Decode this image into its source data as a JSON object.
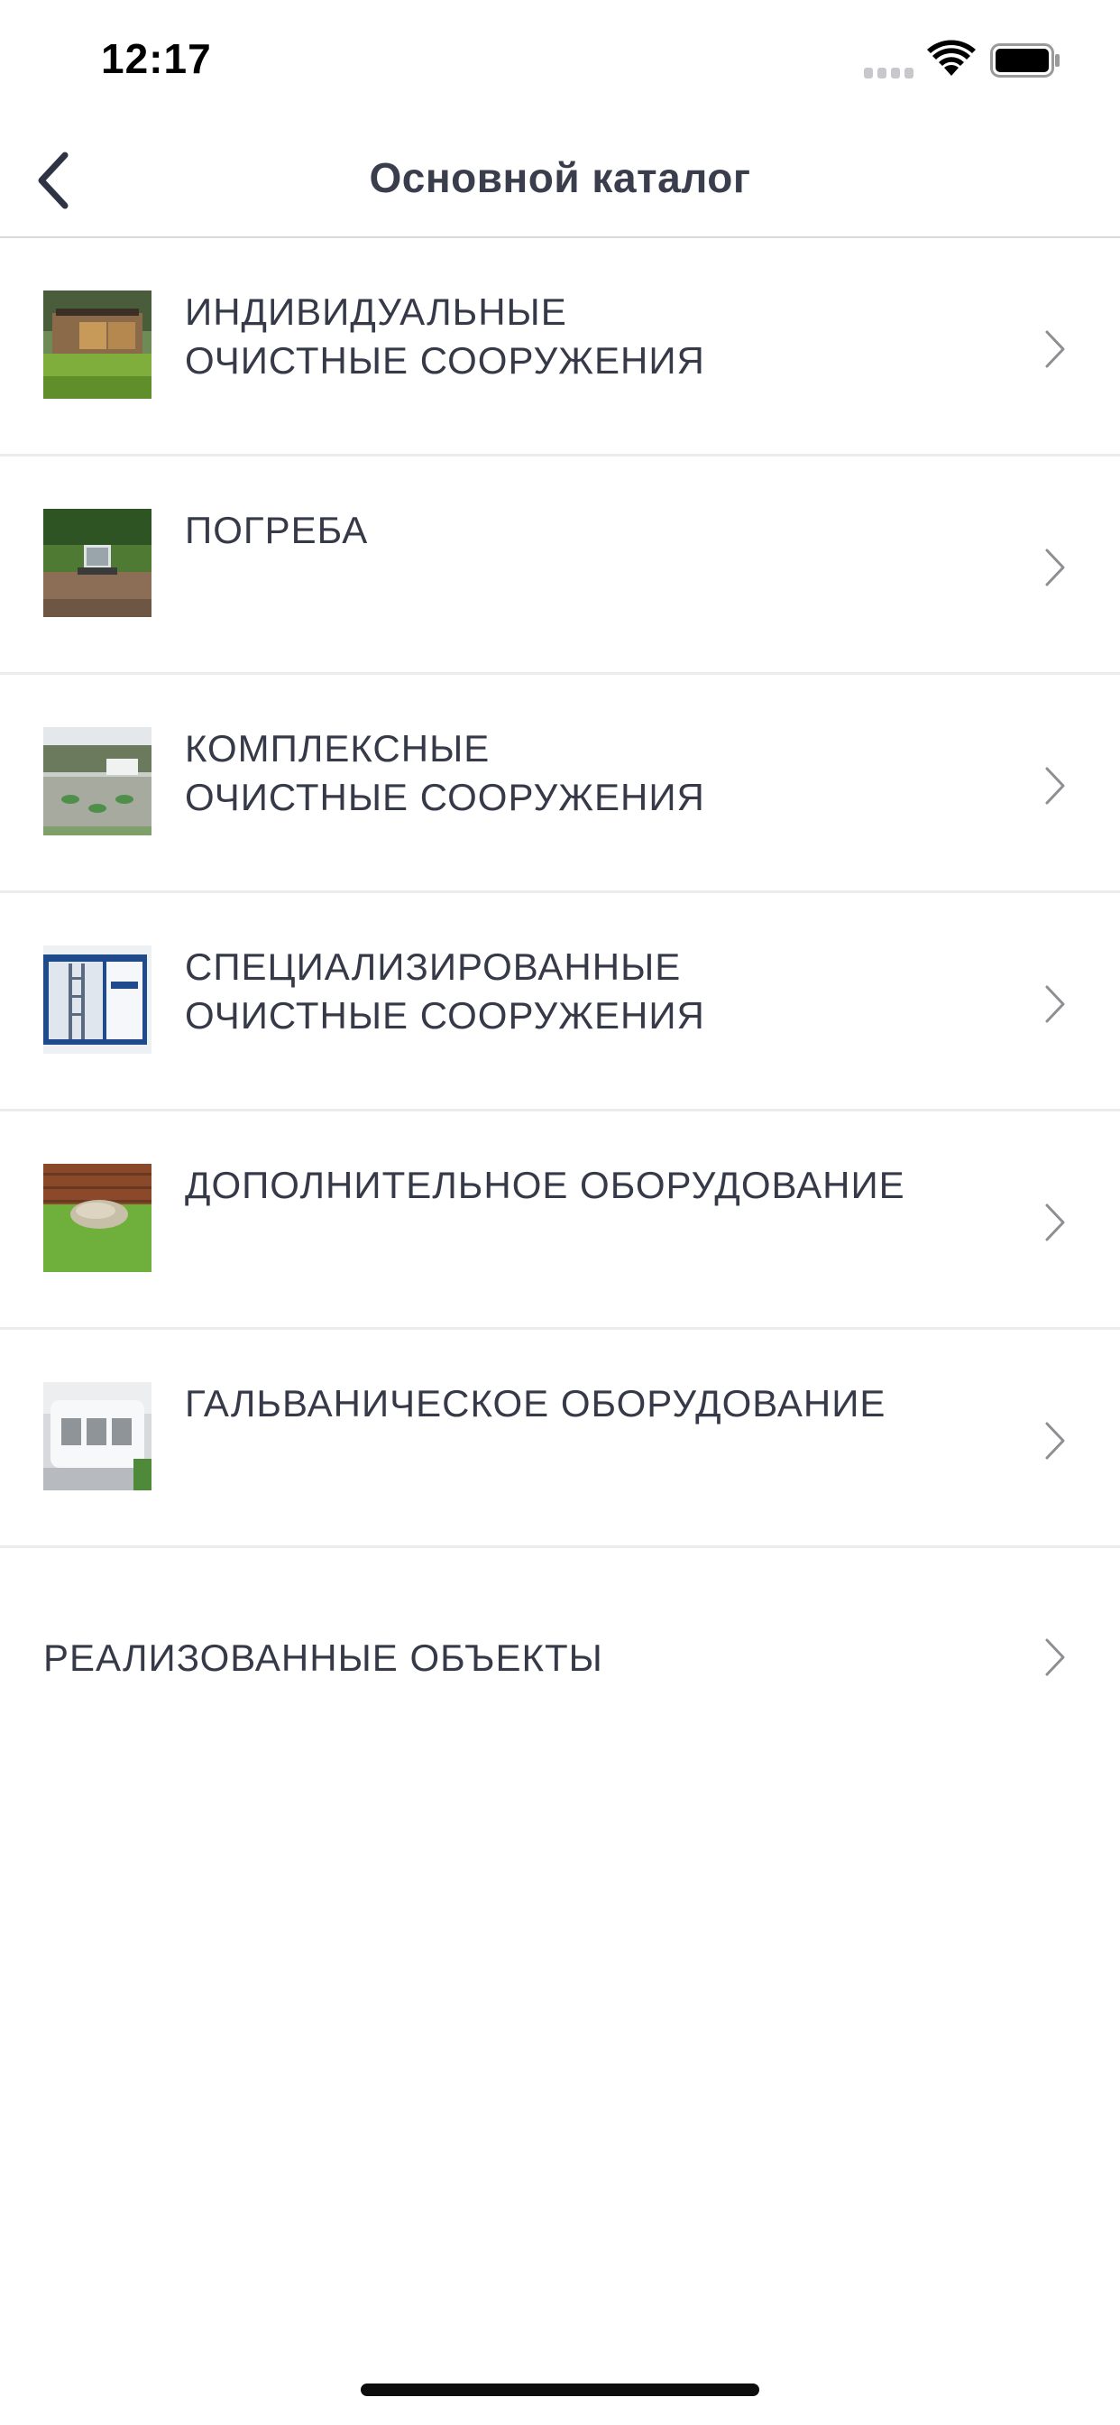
{
  "status_bar": {
    "time": "12:17",
    "signal_icon": "cellular-signal-icon",
    "wifi_icon": "wifi-icon",
    "battery_icon": "battery-icon"
  },
  "nav": {
    "back_icon": "chevron-left-icon",
    "title": "Основной каталог"
  },
  "items": [
    {
      "label": "ИНДИВИДУАЛЬНЫЕ\nОЧИСТНЫЕ СООРУЖЕНИЯ",
      "thumbnail": "house-with-lawn-photo",
      "chevron_icon": "chevron-right-icon"
    },
    {
      "label": "ПОГРЕБА",
      "thumbnail": "cellar-hatch-photo",
      "chevron_icon": "chevron-right-icon"
    },
    {
      "label": "КОМПЛЕКСНЫЕ\nОЧИСТНЫЕ СООРУЖЕНИЯ",
      "thumbnail": "treatment-site-photo",
      "chevron_icon": "chevron-right-icon"
    },
    {
      "label": "СПЕЦИАЛИЗИРОВАННЫЕ\nОЧИСТНЫЕ СООРУЖЕНИЯ",
      "thumbnail": "blue-container-photo",
      "chevron_icon": "chevron-right-icon"
    },
    {
      "label": "ДОПОЛНИТЕЛЬНОЕ ОБОРУДОВАНИЕ",
      "thumbnail": "stone-on-grass-photo",
      "chevron_icon": "chevron-right-icon"
    },
    {
      "label": "ГАЛЬВАНИЧЕСКОЕ ОБОРУДОВАНИЕ",
      "thumbnail": "galvanic-tank-photo",
      "chevron_icon": "chevron-right-icon"
    },
    {
      "label": "РЕАЛИЗОВАННЫЕ ОБЪЕКТЫ",
      "chevron_icon": "chevron-right-icon"
    }
  ],
  "colors": {
    "text": "#363a48",
    "separator": "#ececec",
    "chevron": "#8e8e93"
  }
}
